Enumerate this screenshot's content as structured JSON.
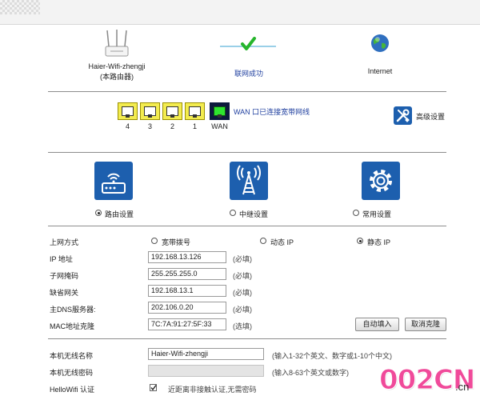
{
  "status": {
    "router_name": "Haier-Wifi-zhengji",
    "router_sub": "(本路由器)",
    "connection_text": "联网成功",
    "internet_label": "Internet"
  },
  "ports": {
    "lan": [
      "4",
      "3",
      "2",
      "1"
    ],
    "wan_label": "WAN",
    "wan_message": "WAN 口已连接宽带网线"
  },
  "advanced_label": "高级设置",
  "modes": [
    {
      "label": "路由设置",
      "selected": true
    },
    {
      "label": "中继设置",
      "selected": false
    },
    {
      "label": "常用设置",
      "selected": false
    }
  ],
  "wan_settings": {
    "type_label": "上网方式",
    "options": [
      "宽带拨号",
      "动态 IP",
      "静态 IP"
    ],
    "selected_option": "静态 IP",
    "fields": [
      {
        "label": "IP 地址",
        "value": "192.168.13.126",
        "hint": "(必填)"
      },
      {
        "label": "子网掩码",
        "value": "255.255.255.0",
        "hint": "(必填)"
      },
      {
        "label": "缺省网关",
        "value": "192.168.13.1",
        "hint": "(必填)"
      },
      {
        "label": "主DNS服务器:",
        "value": "202.106.0.20",
        "hint": "(必填)"
      },
      {
        "label": "MAC地址克隆",
        "value": "7C:7A:91:27:5F:33",
        "hint": "(选填)"
      }
    ],
    "auto_fill_button": "自动填入",
    "cancel_clone_button": "取消克隆"
  },
  "wireless": {
    "name_label": "本机无线名称",
    "name_value": "Haier-Wifi-zhengji",
    "name_hint": "(输入1-32个英文、数字或1-10个中文)",
    "password_label": "本机无线密码",
    "password_value": "",
    "password_hint": "(输入8-63个英文或数字)",
    "hellowifi_label": "HelloWifi 认证",
    "hellowifi_text": "近距离非接触认证,无需密码"
  },
  "watermark": {
    "text": "002CN",
    "suffix": ".cn"
  },
  "colors": {
    "accent_blue": "#1d5fae",
    "port_yellow": "#f3ec4f",
    "wan_green": "#2fe52f",
    "check_green": "#26b52b"
  }
}
